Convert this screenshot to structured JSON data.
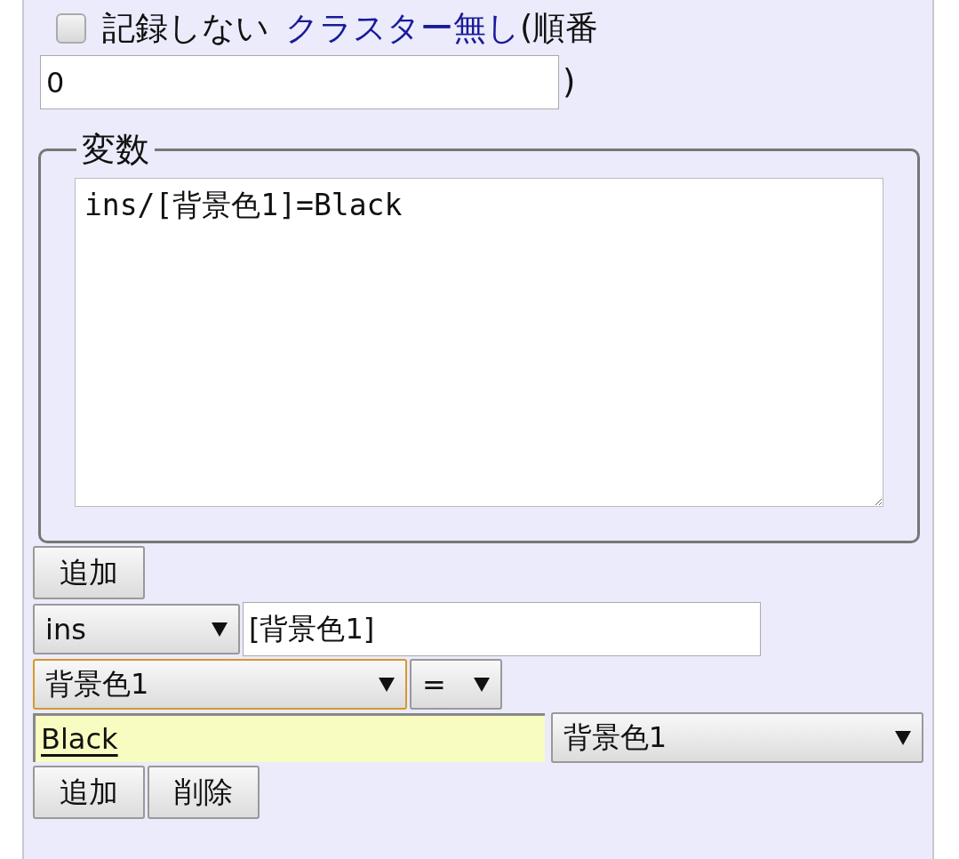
{
  "record_option": {
    "checked": false,
    "label": "記録しない",
    "link": "クラスター無し",
    "paren_open": "(順番",
    "order_value": "0",
    "paren_close": ")"
  },
  "variables": {
    "legend": "変数",
    "text": "ins/[背景色1]=Black"
  },
  "add_button_top": "追加",
  "editor_rows": [
    {
      "items": [
        {
          "kind": "dropdown",
          "value": "ins",
          "focused": false
        },
        {
          "kind": "input",
          "value": "[背景色1]"
        }
      ]
    },
    {
      "items": [
        {
          "kind": "dropdown",
          "value": "背景色1",
          "focused": true
        },
        {
          "kind": "dropdown",
          "value": "=",
          "focused": false
        }
      ]
    },
    {
      "items": [
        {
          "kind": "input",
          "value": "Black",
          "highlighted": true
        },
        {
          "kind": "dropdown",
          "value": "背景色1",
          "focused": false
        }
      ]
    }
  ],
  "bottom_buttons": [
    "追加",
    "削除"
  ]
}
